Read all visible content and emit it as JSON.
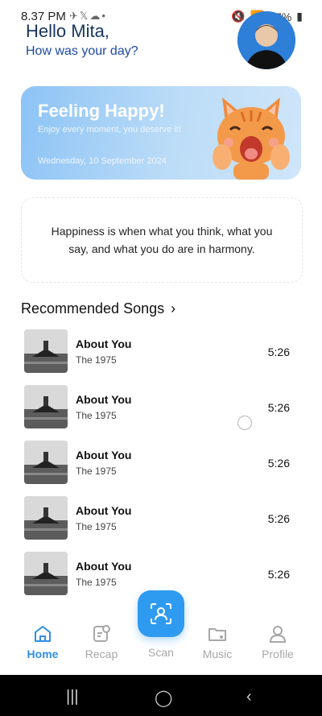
{
  "status_bar": {
    "time": "8.37 PM",
    "battery": "67%"
  },
  "header": {
    "greeting": "Hello Mita,",
    "subtitle": "How was your day?"
  },
  "mood_card": {
    "title": "Feeling Happy!",
    "subtitle": "Enjoy every moment, you deserve it!",
    "date": "Wednesday, 10 September 2024"
  },
  "quote": {
    "text": "Happiness is when what you think, what you say, and what you do are in harmony."
  },
  "recommended": {
    "title": "Recommended Songs",
    "songs": [
      {
        "title": "About You",
        "artist": "The 1975",
        "duration": "5:26"
      },
      {
        "title": "About You",
        "artist": "The 1975",
        "duration": "5:26"
      },
      {
        "title": "About You",
        "artist": "The 1975",
        "duration": "5:26"
      },
      {
        "title": "About You",
        "artist": "The 1975",
        "duration": "5:26"
      },
      {
        "title": "About You",
        "artist": "The 1975",
        "duration": "5:26"
      }
    ]
  },
  "bottom_nav": {
    "items": [
      {
        "label": "Home",
        "icon": "home-icon",
        "active": true
      },
      {
        "label": "Recap",
        "icon": "recap-icon",
        "active": false
      },
      {
        "label": "Scan",
        "icon": "face-scan-icon",
        "active": false
      },
      {
        "label": "Music",
        "icon": "music-folder-icon",
        "active": false
      },
      {
        "label": "Profile",
        "icon": "profile-icon",
        "active": false
      }
    ]
  },
  "colors": {
    "accent": "#2f8fe6",
    "fab": "#2f9bf0",
    "inactive": "#a7a7a7"
  }
}
